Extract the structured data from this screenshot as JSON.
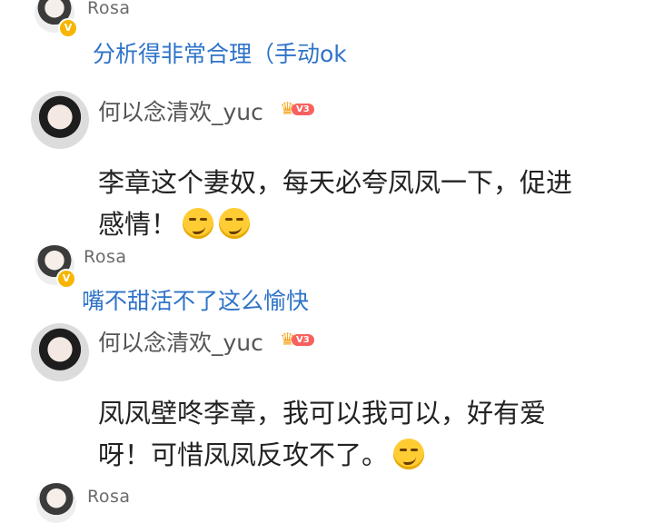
{
  "comments": [
    {
      "username": "Rosa",
      "text": "分析得非常合理（手动ok"
    },
    {
      "username": "何以念清欢_yuc",
      "vip_level": "V3",
      "text_line1": "李章这个妻奴，每天必夸凤凤一下，促进",
      "text_line2": "感情！"
    },
    {
      "username": "Rosa",
      "text": "嘴不甜活不了这么愉快"
    },
    {
      "username": "何以念清欢_yuc",
      "vip_level": "V3",
      "text_line1": "凤凤壁咚李章，我可以我可以，好有爱",
      "text_line2": "呀！可惜凤凤反攻不了。"
    },
    {
      "username": "Rosa"
    }
  ],
  "badge_symbol": "V",
  "emoji": "smirk-emoji"
}
